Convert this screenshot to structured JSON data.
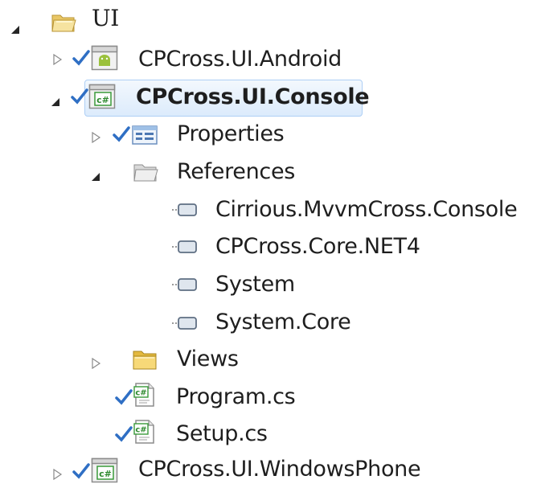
{
  "tree": {
    "root": {
      "label": "UI",
      "expanded": true,
      "icon": "folder-open-icon"
    },
    "projects": [
      {
        "label": "CPCross.UI.Android",
        "expanded": false,
        "checked": true,
        "icon": "android-project-icon"
      },
      {
        "label": "CPCross.UI.Console",
        "expanded": true,
        "checked": true,
        "selected": true,
        "icon": "csharp-project-icon",
        "children": [
          {
            "label": "Properties",
            "expanded": false,
            "checked": true,
            "icon": "properties-icon"
          },
          {
            "label": "References",
            "expanded": true,
            "icon": "references-folder-icon",
            "children": [
              {
                "label": "Cirrious.MvvmCross.Console",
                "icon": "reference-icon"
              },
              {
                "label": "CPCross.Core.NET4",
                "icon": "reference-icon"
              },
              {
                "label": "System",
                "icon": "reference-icon"
              },
              {
                "label": "System.Core",
                "icon": "reference-icon"
              }
            ]
          },
          {
            "label": "Views",
            "expanded": false,
            "icon": "folder-icon"
          },
          {
            "label": "Program.cs",
            "checked": true,
            "icon": "csharp-file-icon"
          },
          {
            "label": "Setup.cs",
            "checked": true,
            "icon": "csharp-file-icon"
          }
        ]
      },
      {
        "label": "CPCross.UI.WindowsPhone",
        "expanded": false,
        "checked": true,
        "icon": "csharp-project-icon"
      }
    ]
  }
}
